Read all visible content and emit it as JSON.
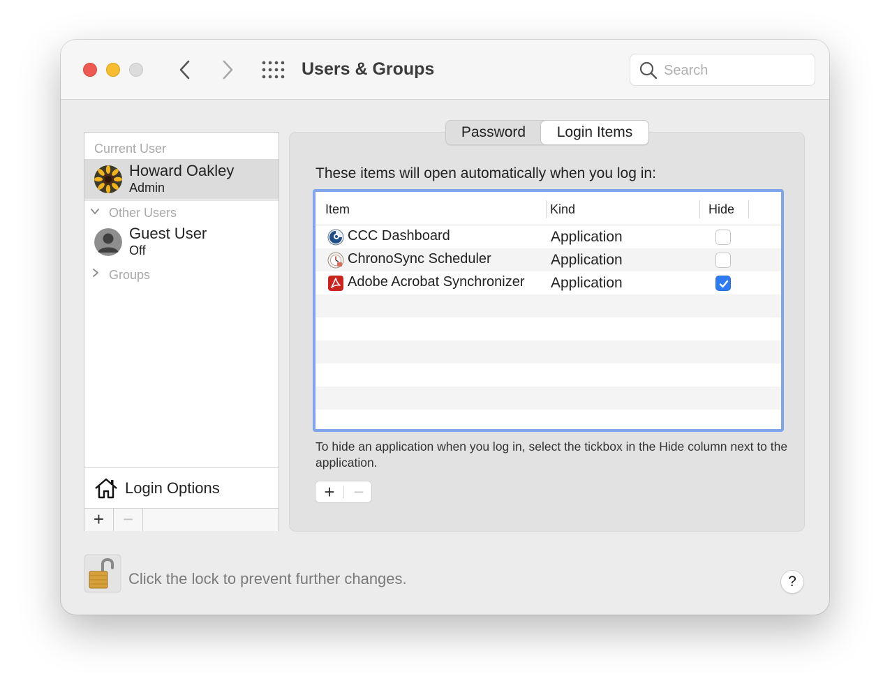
{
  "window": {
    "title": "Users & Groups",
    "search_placeholder": "Search"
  },
  "sidebar": {
    "current_user_label": "Current User",
    "current_user": {
      "name": "Howard Oakley",
      "role": "Admin"
    },
    "other_users_label": "Other Users",
    "other_users": [
      {
        "name": "Guest User",
        "status": "Off"
      }
    ],
    "groups_label": "Groups",
    "login_options_label": "Login Options",
    "add_label": "+",
    "remove_label": "−"
  },
  "tabs": [
    {
      "label": "Password",
      "selected": false
    },
    {
      "label": "Login Items",
      "selected": true
    }
  ],
  "login_items": {
    "intro": "These items will open automatically when you log in:",
    "columns": [
      "Item",
      "Kind",
      "Hide"
    ],
    "rows": [
      {
        "item": "CCC Dashboard",
        "kind": "Application",
        "hide": false,
        "icon": "ccc-dashboard-icon"
      },
      {
        "item": "ChronoSync Scheduler",
        "kind": "Application",
        "hide": false,
        "icon": "chronosync-icon"
      },
      {
        "item": "Adobe Acrobat Synchronizer",
        "kind": "Application",
        "hide": true,
        "icon": "acrobat-icon"
      }
    ],
    "help": "To hide an application when you log in, select the tickbox in the Hide column next to the application.",
    "add_label": "+",
    "remove_label": "−"
  },
  "footer": {
    "lock_text": "Click the lock to prevent further changes.",
    "help_label": "?"
  },
  "colors": {
    "accent": "#2f7bf5",
    "table_focus_ring": "#7fa6ea",
    "close": "#ee5a52",
    "minimize": "#f5bd2f"
  }
}
